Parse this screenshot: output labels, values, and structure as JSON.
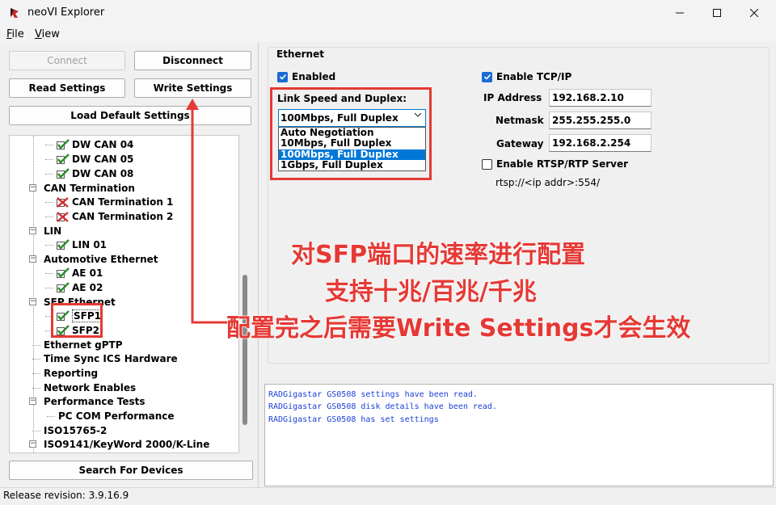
{
  "window": {
    "title": "neoVI Explorer"
  },
  "menu": {
    "file": {
      "mnemonic": "F",
      "rest": "ile"
    },
    "view": {
      "mnemonic": "V",
      "rest": "iew"
    }
  },
  "buttons": {
    "connect": "Connect",
    "disconnect": "Disconnect",
    "read_settings": "Read Settings",
    "write_settings": "Write Settings",
    "load_default": "Load Default Settings",
    "search_devices": "Search For Devices"
  },
  "tree": {
    "items": [
      {
        "label": "DW CAN 04",
        "icon": "check-icon"
      },
      {
        "label": "DW CAN 05",
        "icon": "check-icon"
      },
      {
        "label": "DW CAN 08",
        "icon": "check-icon"
      },
      {
        "label": "CAN Termination",
        "icon": ""
      },
      {
        "label": "CAN Termination 1",
        "icon": "cross-icon"
      },
      {
        "label": "CAN Termination 2",
        "icon": "cross-icon"
      },
      {
        "label": "LIN",
        "icon": ""
      },
      {
        "label": "LIN 01",
        "icon": "check-icon"
      },
      {
        "label": "Automotive Ethernet",
        "icon": ""
      },
      {
        "label": "AE 01",
        "icon": "check-icon"
      },
      {
        "label": "AE 02",
        "icon": "check-icon"
      },
      {
        "label": "SFP Ethernet",
        "icon": ""
      },
      {
        "label": "SFP1",
        "icon": "check-icon"
      },
      {
        "label": "SFP2",
        "icon": "check-icon"
      },
      {
        "label": "Ethernet gPTP",
        "icon": ""
      },
      {
        "label": "Time Sync ICS Hardware",
        "icon": ""
      },
      {
        "label": "Reporting",
        "icon": ""
      },
      {
        "label": "Network Enables",
        "icon": ""
      },
      {
        "label": "Performance Tests",
        "icon": ""
      },
      {
        "label": "PC COM Performance",
        "icon": ""
      },
      {
        "label": "ISO15765-2",
        "icon": ""
      },
      {
        "label": "ISO9141/KeyWord 2000/K-Line",
        "icon": ""
      }
    ]
  },
  "ethernet": {
    "group_title": "Ethernet",
    "enabled_label": "Enabled",
    "enabled": true,
    "link_speed_label": "Link Speed and Duplex:",
    "link_speed_value": "100Mbps, Full Duplex",
    "link_speed_options": [
      "Auto Negotiation",
      "10Mbps, Full Duplex",
      "100Mbps, Full Duplex",
      "1Gbps, Full Duplex"
    ],
    "selected_option_index": 2,
    "tcpip_label": "Enable TCP/IP",
    "tcpip_enabled": true,
    "ip_label": "IP Address",
    "ip_value": "192.168.2.10",
    "netmask_label": "Netmask",
    "netmask_value": "255.255.255.0",
    "gateway_label": "Gateway",
    "gateway_value": "192.168.2.254",
    "rtsp_label": "Enable RTSP/RTP Server",
    "rtsp_enabled": false,
    "rtsp_url": "rtsp://<ip addr>:554/"
  },
  "log": {
    "lines": [
      "RADGigastar GS0508 settings have been read.",
      "RADGigastar GS0508 disk details have been read.",
      "RADGigastar GS0508 has set settings"
    ]
  },
  "status": {
    "text": "Release revision: 3.9.16.9"
  },
  "annotations": {
    "line1": "对SFP端口的速率进行配置",
    "line2": "支持十兆/百兆/千兆",
    "line3": "配置完之后需要Write Settings才会生效"
  },
  "colors": {
    "accent": "#0078d7",
    "annotation_red": "#e53935",
    "log_text": "#1a3fd6"
  }
}
